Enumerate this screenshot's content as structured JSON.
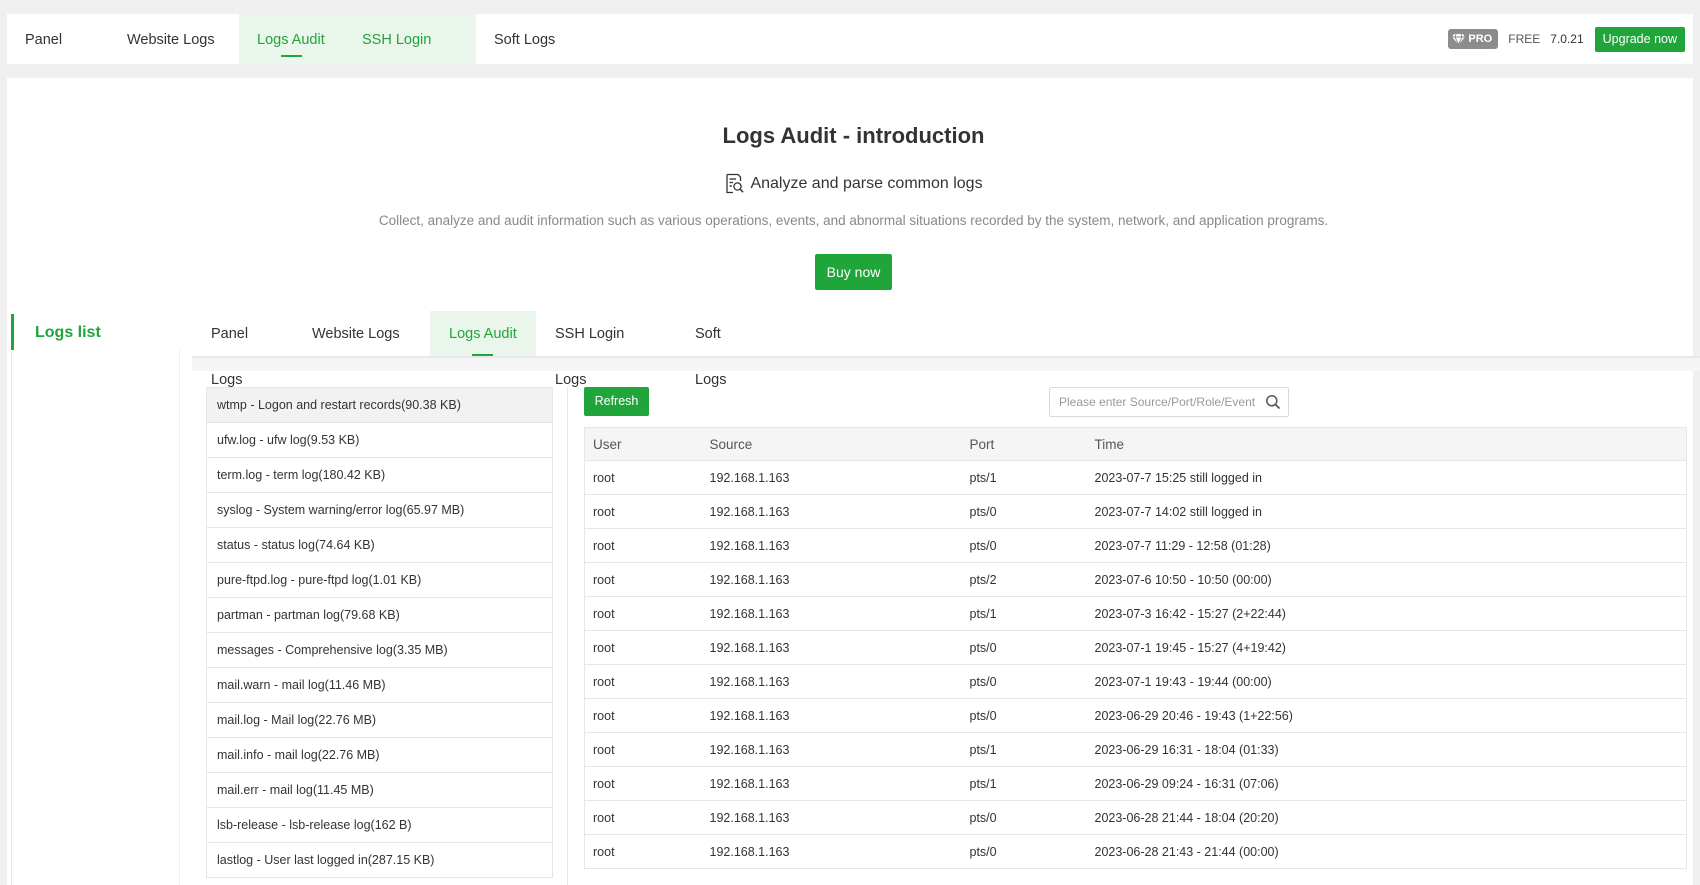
{
  "top_tabs": [
    {
      "label": "Panel Logs"
    },
    {
      "label": "Website Logs"
    },
    {
      "label": "Logs Audit"
    },
    {
      "label": "SSH Login Logs"
    },
    {
      "label": "Soft Logs"
    }
  ],
  "header": {
    "pro_badge": "PRO",
    "free_label": "FREE",
    "version": "7.0.21",
    "upgrade_label": "Upgrade now"
  },
  "intro": {
    "title": "Logs Audit - introduction",
    "subtitle": "Analyze and parse common logs",
    "description": "Collect, analyze and audit information such as various operations, events, and abnormal situations recorded by the system, network, and application programs.",
    "buy_label": "Buy now"
  },
  "sidebar": {
    "title": "Logs list"
  },
  "inner_tabs": [
    {
      "label": "Panel Logs"
    },
    {
      "label": "Website Logs"
    },
    {
      "label": "Logs Audit"
    },
    {
      "label": "SSH Login Logs"
    },
    {
      "label": "Soft Logs"
    }
  ],
  "log_files": [
    "wtmp - Logon and restart records(90.38 KB)",
    "ufw.log - ufw log(9.53 KB)",
    "term.log - term log(180.42 KB)",
    "syslog - System warning/error log(65.97 MB)",
    "status - status log(74.64 KB)",
    "pure-ftpd.log - pure-ftpd log(1.01 KB)",
    "partman - partman log(79.68 KB)",
    "messages - Comprehensive log(3.35 MB)",
    "mail.warn - mail log(11.46 MB)",
    "mail.log - Mail log(22.76 MB)",
    "mail.info - mail log(22.76 MB)",
    "mail.err - mail log(11.45 MB)",
    "lsb-release - lsb-release log(162 B)",
    "lastlog - User last logged in(287.15 KB)"
  ],
  "toolbar": {
    "refresh_label": "Refresh",
    "search_placeholder": "Please enter Source/Port/Role/Event"
  },
  "table": {
    "columns": [
      "User",
      "Source",
      "Port",
      "Time"
    ],
    "rows": [
      [
        "root",
        "192.168.1.163",
        "pts/1",
        "2023-07-7 15:25 still logged in"
      ],
      [
        "root",
        "192.168.1.163",
        "pts/0",
        "2023-07-7 14:02 still logged in"
      ],
      [
        "root",
        "192.168.1.163",
        "pts/0",
        "2023-07-7 11:29 - 12:58 (01:28)"
      ],
      [
        "root",
        "192.168.1.163",
        "pts/2",
        "2023-07-6 10:50 - 10:50 (00:00)"
      ],
      [
        "root",
        "192.168.1.163",
        "pts/1",
        "2023-07-3 16:42 - 15:27 (2+22:44)"
      ],
      [
        "root",
        "192.168.1.163",
        "pts/0",
        "2023-07-1 19:45 - 15:27 (4+19:42)"
      ],
      [
        "root",
        "192.168.1.163",
        "pts/0",
        "2023-07-1 19:43 - 19:44 (00:00)"
      ],
      [
        "root",
        "192.168.1.163",
        "pts/0",
        "2023-06-29 20:46 - 19:43 (1+22:56)"
      ],
      [
        "root",
        "192.168.1.163",
        "pts/1",
        "2023-06-29 16:31 - 18:04 (01:33)"
      ],
      [
        "root",
        "192.168.1.163",
        "pts/1",
        "2023-06-29 09:24 - 16:31 (07:06)"
      ],
      [
        "root",
        "192.168.1.163",
        "pts/0",
        "2023-06-28 21:44 - 18:04 (20:20)"
      ],
      [
        "root",
        "192.168.1.163",
        "pts/0",
        "2023-06-28 21:43 - 21:44 (00:00)"
      ]
    ]
  },
  "colors": {
    "accent": "#20a53a",
    "accent_light": "#eaf5ec",
    "badge": "#8c8c8c"
  }
}
